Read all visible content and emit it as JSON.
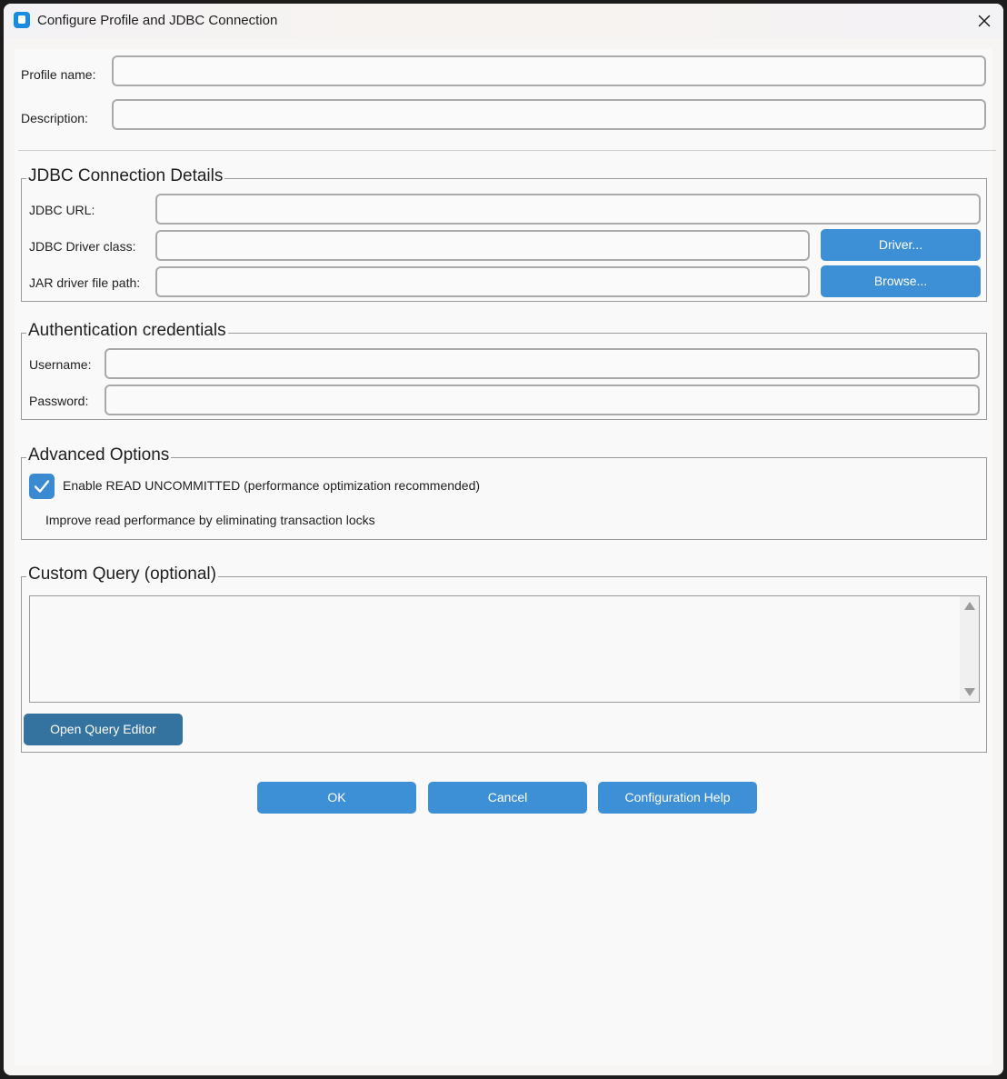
{
  "window": {
    "title": "Configure Profile and JDBC Connection"
  },
  "profile": {
    "name_label": "Profile name:",
    "name_value": "",
    "description_label": "Description:",
    "description_value": ""
  },
  "jdbc": {
    "group_title": "JDBC Connection Details",
    "url_label": "JDBC URL:",
    "url_value": "",
    "driver_class_label": "JDBC Driver class:",
    "driver_class_value": "",
    "driver_button": "Driver...",
    "jar_path_label": "JAR driver file path:",
    "jar_path_value": "",
    "browse_button": "Browse..."
  },
  "auth": {
    "group_title": "Authentication credentials",
    "username_label": "Username:",
    "username_value": "",
    "password_label": "Password:",
    "password_value": ""
  },
  "advanced": {
    "group_title": "Advanced Options",
    "read_uncommitted_label": "Enable READ UNCOMMITTED (performance optimization recommended)",
    "read_uncommitted_checked": true,
    "read_uncommitted_hint": "Improve read performance by eliminating transaction locks"
  },
  "custom_query": {
    "group_title": "Custom Query (optional)",
    "query_value": "",
    "open_editor_button": "Open Query Editor"
  },
  "footer": {
    "ok_button": "OK",
    "cancel_button": "Cancel",
    "help_button": "Configuration Help"
  },
  "icons": {
    "app": "app-icon",
    "close": "close-icon",
    "check": "checkmark-icon",
    "scroll_up": "scroll-up-arrow-icon",
    "scroll_down": "scroll-down-arrow-icon"
  },
  "colors": {
    "accent": "#3d8fd6",
    "accent_dark": "#34729f",
    "checkbox": "#3a8ad1",
    "window_bg": "#f9f9f9",
    "title_icon": "#1a8ce0"
  }
}
